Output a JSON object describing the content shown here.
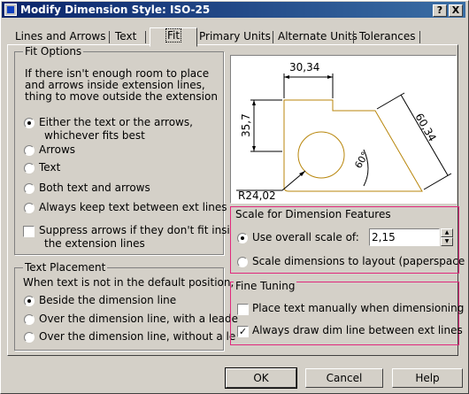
{
  "window": {
    "title": "Modify Dimension Style: ISO-25",
    "help_label": "?",
    "close_label": "X"
  },
  "tabs": [
    {
      "label": "Lines and Arrows"
    },
    {
      "label": "Text"
    },
    {
      "label": "Fit"
    },
    {
      "label": "Primary Units"
    },
    {
      "label": "Alternate Units"
    },
    {
      "label": "Tolerances"
    }
  ],
  "fit_options": {
    "title": "Fit Options",
    "description": [
      "If there isn't enough room to place",
      "and arrows inside extension lines,",
      "thing to move outside the extension"
    ],
    "options": [
      {
        "label": "Either the text or the arrows,",
        "label2": "whichever fits best",
        "selected": true
      },
      {
        "label": "Arrows",
        "selected": false
      },
      {
        "label": "Text",
        "selected": false
      },
      {
        "label": "Both text and arrows",
        "selected": false
      },
      {
        "label": "Always keep text between ext lines",
        "selected": false
      }
    ],
    "suppress": {
      "label": "Suppress arrows if they don't fit insi",
      "label2": "the extension lines",
      "checked": false
    }
  },
  "text_placement": {
    "title": "Text Placement",
    "description": "When text is not in the default position,",
    "options": [
      {
        "label": "Beside the dimension line",
        "selected": true
      },
      {
        "label": "Over the dimension line, with a leade",
        "selected": false
      },
      {
        "label": "Over the dimension line, without a le",
        "selected": false
      }
    ]
  },
  "preview": {
    "dim_top": "30,34",
    "dim_left": "35,7",
    "dim_right": "60,34",
    "dim_angle": "60°",
    "dim_radius": "R24,02"
  },
  "scale": {
    "title": "Scale for Dimension Features",
    "use_overall_label": "Use overall scale of:",
    "overall_value": "2,15",
    "layout_label": "Scale dimensions to layout (paperspace",
    "use_overall_selected": true
  },
  "fine_tuning": {
    "title": "Fine Tuning",
    "place_manually": {
      "label": "Place text manually when dimensioning",
      "checked": false
    },
    "always_draw": {
      "label": "Always draw dim line between ext lines",
      "checked": true
    }
  },
  "buttons": {
    "ok": "OK",
    "cancel": "Cancel",
    "help": "Help"
  },
  "colors": {
    "titlebar": "#0a246a",
    "highlight": "#e0287c",
    "drawing": "#b8860b"
  }
}
